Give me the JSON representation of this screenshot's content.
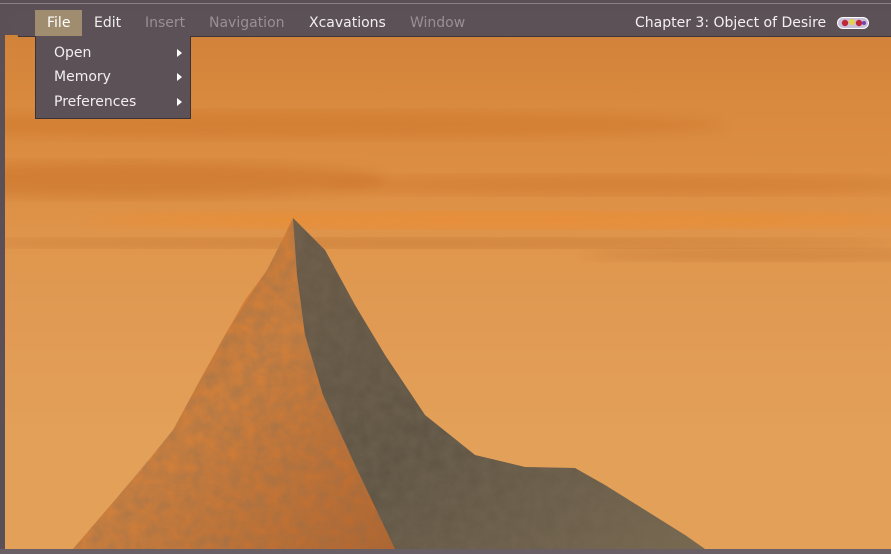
{
  "menubar": {
    "items": [
      {
        "label": "File",
        "state": "active"
      },
      {
        "label": "Edit",
        "state": "enabled"
      },
      {
        "label": "Insert",
        "state": "disabled"
      },
      {
        "label": "Navigation",
        "state": "disabled"
      },
      {
        "label": "Xcavations",
        "state": "enabled"
      },
      {
        "label": "Window",
        "state": "disabled"
      }
    ],
    "chapter_title": "Chapter 3: Object of Desire",
    "badge_icon": "gem-badge-icon"
  },
  "file_menu": {
    "items": [
      {
        "label": "Open",
        "has_submenu": true
      },
      {
        "label": "Memory",
        "has_submenu": true
      },
      {
        "label": "Preferences",
        "has_submenu": true
      }
    ]
  },
  "scene": {
    "subject": "mountain-peak",
    "sky_color": "#dc8e43",
    "rock_lit_color": "#d07a32",
    "rock_shadow_color": "#5a5244"
  },
  "colors": {
    "menubar_bg": "#5d5158",
    "menu_active_bg": "#a08c6e",
    "menu_text": "#f2eef0",
    "menu_disabled_text": "#9a8f95"
  }
}
